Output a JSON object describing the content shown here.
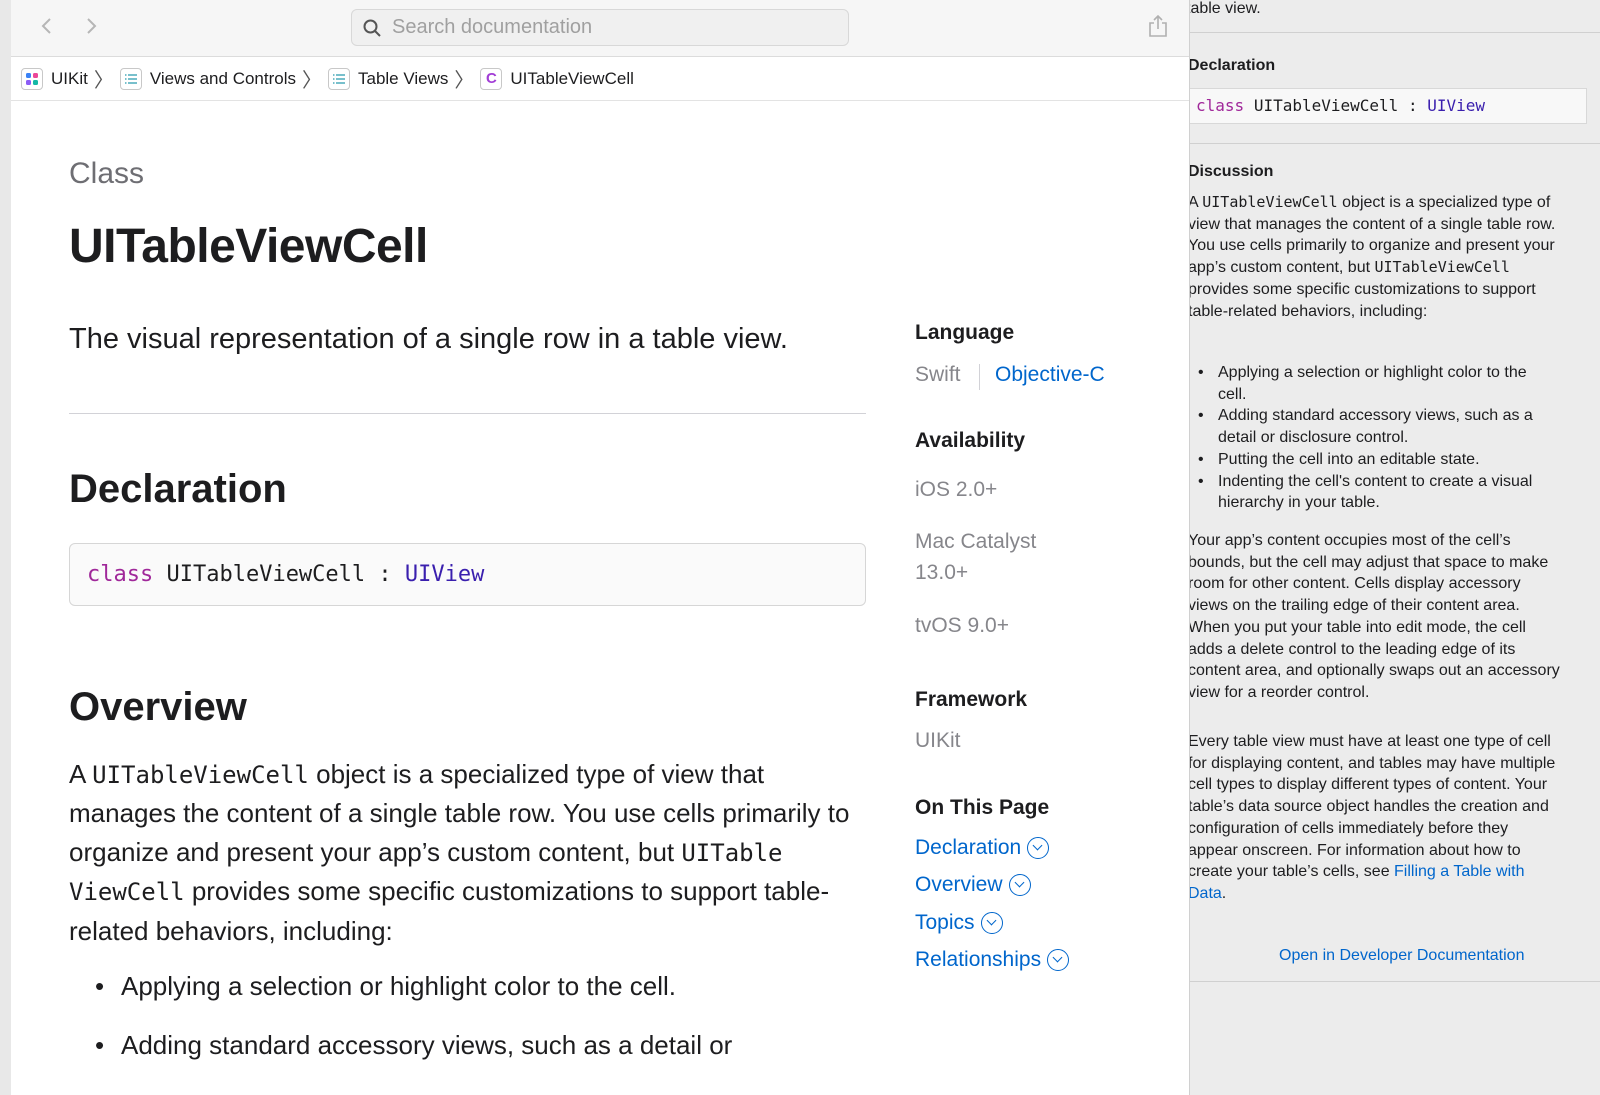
{
  "toolbar": {
    "back_icon": "chevron-left-icon",
    "forward_icon": "chevron-right-icon",
    "search_placeholder": "Search documentation",
    "share_icon": "share-icon"
  },
  "breadcrumb": [
    {
      "label": "UIKit",
      "icon": "framework-icon"
    },
    {
      "label": "Views and Controls",
      "icon": "list-icon"
    },
    {
      "label": "Table Views",
      "icon": "list-icon"
    },
    {
      "label": "UITableViewCell",
      "icon": "class-icon"
    }
  ],
  "page": {
    "kind": "Class",
    "title": "UITableViewCell",
    "abstract": "The visual representation of a single row in a table view.",
    "declaration_heading": "Declaration",
    "declaration": {
      "keyword": "class",
      "name": "UITableViewCell",
      "colon": ":",
      "superclass": "UIView"
    },
    "overview_heading": "Overview",
    "overview": {
      "p1_a": "A ",
      "p1_code1": "UITableViewCell",
      "p1_b": " object is a specialized type of view that manages the content of a single table row. You use cells primarily to organize and present your app’s custom content, but ",
      "p1_code2a": "UITable",
      "p1_code2b": "ViewCell",
      "p1_c": " provides some specific customizations to support table-related behaviors, including:"
    },
    "bullets": [
      "Applying a selection or highlight color to the cell.",
      "Adding standard accessory views, such as a detail or"
    ]
  },
  "sidebar": {
    "language_heading": "Language",
    "lang_swift": "Swift",
    "lang_objc": "Objective-C",
    "availability_heading": "Availability",
    "avail_ios": "iOS 2.0+",
    "avail_catalyst_1": "Mac Catalyst",
    "avail_catalyst_2": "13.0+",
    "avail_tvos": "tvOS 9.0+",
    "framework_heading": "Framework",
    "framework": "UIKit",
    "on_this_page_heading": "On This Page",
    "links": [
      "Declaration",
      "Overview",
      "Topics",
      "Relationships"
    ]
  },
  "quick_help": {
    "top_text": "table view.",
    "declaration_heading": "Declaration",
    "declaration": {
      "keyword": "class",
      "name": "UITableViewCell",
      "colon": ":",
      "superclass": "UIView"
    },
    "discussion_heading": "Discussion",
    "d1_a": "A ",
    "d1_code1": "UITableViewCell",
    "d1_b": " object is a specialized type of view that manages the content of a single table row. You use cells primarily to organize and present your app’s custom content, but ",
    "d1_code2": "UITableViewCell",
    "d1_c": " provides some specific customizations to support table-related behaviors, including:",
    "bullets": [
      "Applying a selection or highlight color to the cell.",
      "Adding standard accessory views, such as a detail or disclosure control.",
      "Putting the cell into an editable state.",
      "Indenting the cell's content to create a visual hierarchy in your table."
    ],
    "d2": "Your app’s content occupies most of the cell’s bounds, but the cell may adjust that space to make room for other content. Cells display accessory views on the trailing edge of their content area. When you put your table into edit mode, the cell adds a delete control to the leading edge of its content area, and optionally swaps out an accessory view for a reorder control.",
    "d3_a": "Every table view must have at least one type of cell for displaying content, and tables may have multiple cell types to display different types of content. Your table’s data source object handles the creation and configuration of cells immediately before they appear onscreen. For information about how to create your table’s cells, see ",
    "d3_link": "Filling a Table with Data",
    "d3_b": ".",
    "open_link": "Open in Developer Documentation"
  },
  "colors": {
    "link": "#0066cc",
    "keyword": "#a0289a",
    "type": "#3a1fae",
    "secondary_text": "#86868b"
  }
}
